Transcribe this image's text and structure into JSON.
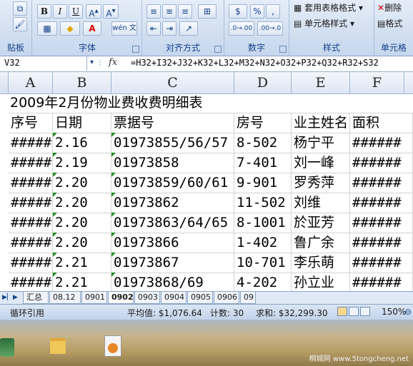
{
  "ribbon": {
    "groups": [
      {
        "label": "贴板"
      },
      {
        "label": "字体"
      },
      {
        "label": "对齐方式"
      },
      {
        "label": "数字"
      },
      {
        "label": "样式"
      },
      {
        "label": "单元格"
      }
    ],
    "font": {
      "bold": "B",
      "italic": "I",
      "underline": "U",
      "wen": "wén 文"
    },
    "number": {
      "percent": "%",
      "comma": ",",
      "inc": ".0→.00",
      "dec": ".00→.0"
    },
    "styles": {
      "table_format": "套用表格格式",
      "cell_styles": "单元格样式"
    },
    "cells": {
      "delete": "删除",
      "format": "格式"
    }
  },
  "formula_bar": {
    "name_box": "V32",
    "fx": "fx",
    "formula": "=H32+I32+J32+K32+L32+M32+N32+O32+P32+Q32+R32+S32"
  },
  "sheet": {
    "columns": [
      "A",
      "B",
      "C",
      "D",
      "E",
      "F"
    ],
    "title": "2009年2月份物业费收费明细表",
    "header": [
      "序号",
      "日期",
      "票据号",
      "房号",
      "业主姓名",
      "面积"
    ],
    "rows": [
      [
        "#####",
        "2.16",
        "01973855/56/57",
        "8-502",
        "杨宁平",
        "######"
      ],
      [
        "#####",
        "2.19",
        "01973858",
        "7-401",
        " 刘一峰",
        "######"
      ],
      [
        "#####",
        "2.20",
        "01973859/60/61",
        "9-901",
        "罗秀萍",
        "######"
      ],
      [
        "#####",
        "2.20",
        "01973862",
        "11-502",
        "刘维",
        "######"
      ],
      [
        "#####",
        "2.20",
        "01973863/64/65",
        "8-1001",
        "於亚芳",
        "######"
      ],
      [
        "#####",
        "2.20",
        "01973866",
        "1-402",
        "鲁广余",
        "######"
      ],
      [
        "#####",
        "2.21",
        "01973867",
        "10-701",
        "李乐萌",
        "######"
      ],
      [
        "#####",
        "2.21",
        "01973868/69",
        "4-202",
        "孙立业",
        "######"
      ]
    ]
  },
  "tabs": {
    "items": [
      "汇总",
      "08.12",
      "0901",
      "0902",
      "0903",
      "0904",
      "0905",
      "0906",
      "09"
    ],
    "active": "0902"
  },
  "status": {
    "mode": "循环引用",
    "average": "平均值: $1,076.64",
    "count": "计数: 30",
    "sum": "求和: $32,299.30",
    "zoom": "150%"
  },
  "desktop": {
    "watermark": "桐城网 www.5tongcheng.net"
  },
  "colors": {
    "accent": "#15428b",
    "ribbon": "#d2dff0",
    "number_flag": "#1e8c1e"
  }
}
